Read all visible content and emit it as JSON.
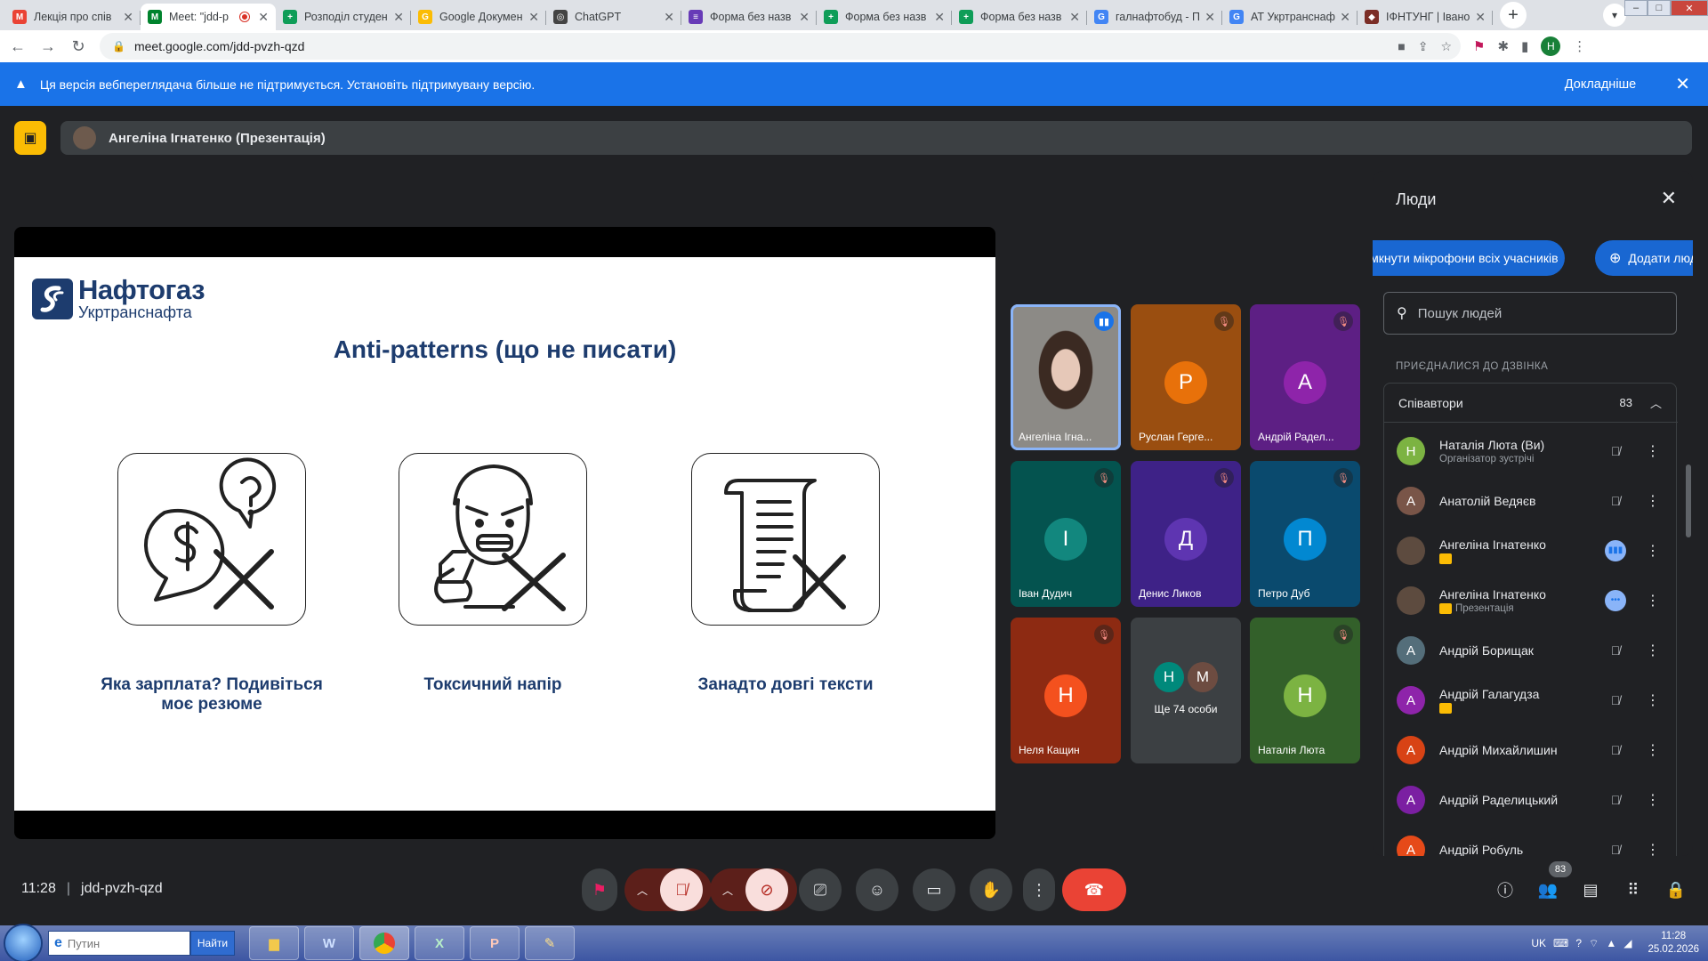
{
  "browser": {
    "tabs": [
      {
        "title": "Лекція про спів",
        "favicon": "M",
        "color": "#ea4335"
      },
      {
        "title": "Meet: \"jdd-p",
        "favicon": "M",
        "color": "#00832d",
        "active": true,
        "recording": true
      },
      {
        "title": "Розподіл студен",
        "favicon": "+",
        "color": "#0f9d58"
      },
      {
        "title": "Google Докумен",
        "favicon": "G",
        "color": "#fbbc04"
      },
      {
        "title": "ChatGPT",
        "favicon": "◎",
        "color": "#444444"
      },
      {
        "title": "Форма без назв",
        "favicon": "≡",
        "color": "#673ab7"
      },
      {
        "title": "Форма без назв",
        "favicon": "+",
        "color": "#0f9d58"
      },
      {
        "title": "Форма без назв",
        "favicon": "+",
        "color": "#0f9d58"
      },
      {
        "title": "галнафтобуд - П",
        "favicon": "G",
        "color": "#4285f4"
      },
      {
        "title": "АТ Укртранснаф",
        "favicon": "G",
        "color": "#4285f4"
      },
      {
        "title": "ІФНТУНГ | Івано",
        "favicon": "◆",
        "color": "#7b2d26"
      }
    ],
    "new_tab_label": "+",
    "url": "meet.google.com/jdd-pvzh-qzd",
    "profile_initial": "Н"
  },
  "banner": {
    "message": "Ця версія вебпереглядача більше не підтримується. Установіть підтримувану версію.",
    "more_label": "Докладніше"
  },
  "presentation": {
    "presenter_label": "Ангеліна Ігнатенко (Презентація)"
  },
  "slide": {
    "logo_title": "Нафтогаз",
    "logo_subtitle": "Укртранснафта",
    "title": "Anti-patterns (що не писати)",
    "captions": [
      "Яка зарплата? Подивіться моє резюме",
      "Токсичний напір",
      "Занадто довгі тексти"
    ]
  },
  "tiles": [
    {
      "name": "Ангеліна Ігна...",
      "initial": "",
      "bg": "#6b6661",
      "avatar_color": "",
      "mic": "talking",
      "video": true,
      "highlight": true
    },
    {
      "name": "Руслан Герге...",
      "initial": "Р",
      "bg": "#9a4e10",
      "avatar_color": "#e8710a",
      "mic": "off"
    },
    {
      "name": "Андрій Радел...",
      "initial": "А",
      "bg": "#5d1f84",
      "avatar_color": "#8e24aa",
      "mic": "off"
    },
    {
      "name": "Іван Дудич",
      "initial": "І",
      "bg": "#04534f",
      "avatar_color": "#12877e",
      "mic": "off"
    },
    {
      "name": "Денис Ликов",
      "initial": "Д",
      "bg": "#3e2287",
      "avatar_color": "#5e35b1",
      "mic": "off"
    },
    {
      "name": "Петро Дуб",
      "initial": "П",
      "bg": "#0a4a6e",
      "avatar_color": "#0288d1",
      "mic": "off"
    },
    {
      "name": "Неля Кащин",
      "initial": "Н",
      "bg": "#8d2a12",
      "avatar_color": "#f4511e",
      "mic": "off"
    },
    {
      "name": "",
      "initial": "",
      "bg": "#3c4043",
      "more_label": "Ще 74 особи",
      "more_initials": [
        "Н",
        "М"
      ],
      "more_colors": [
        "#00897b",
        "#6d4c41"
      ]
    },
    {
      "name": "Наталія Люта",
      "initial": "Н",
      "bg": "#33602a",
      "avatar_color": "#7cb342",
      "mic": "off"
    }
  ],
  "people_panel": {
    "title": "Люди",
    "mute_all_label": "Вимкнути мікрофони всіх учасників",
    "add_people_label": "Додати люде",
    "search_placeholder": "Пошук людей",
    "joined_label": "ПРИЄДНАЛИСЯ ДО ДЗВІНКА",
    "group_label": "Співавтори",
    "group_count": "83",
    "people": [
      {
        "name": "Наталія Люта (Ви)",
        "sub": "Організатор зустрічі",
        "initial": "Н",
        "color": "#7cb342",
        "mic": "off"
      },
      {
        "name": "Анатолій Ведяєв",
        "sub": "",
        "initial": "А",
        "color": "#795548",
        "mic": "off"
      },
      {
        "name": "Ангеліна Ігнатенко",
        "sub": "",
        "initial": "",
        "color": "#5d4b3f",
        "mic": "talking",
        "tag": true
      },
      {
        "name": "Ангеліна Ігнатенко",
        "sub": "Презентація",
        "initial": "",
        "color": "#5d4b3f",
        "mic": "idle",
        "tag": true
      },
      {
        "name": "Андрій Борищак",
        "sub": "",
        "initial": "А",
        "color": "#546e7a",
        "mic": "off"
      },
      {
        "name": "Андрій Галагудза",
        "sub": "",
        "initial": "А",
        "color": "#8e24aa",
        "mic": "off",
        "tag": true
      },
      {
        "name": "Андрій Михайлишин",
        "sub": "",
        "initial": "А",
        "color": "#d84315",
        "mic": "off"
      },
      {
        "name": "Андрій Раделицький",
        "sub": "",
        "initial": "А",
        "color": "#7b1fa2",
        "mic": "off"
      },
      {
        "name": "Андрій Робуль",
        "sub": "",
        "initial": "А",
        "color": "#e64a19",
        "mic": "off"
      }
    ]
  },
  "controls": {
    "time": "11:28",
    "meeting_code": "jdd-pvzh-qzd",
    "people_count": "83"
  },
  "taskbar": {
    "search_value": "Путин",
    "search_button": "Найти",
    "language": "UK",
    "clock_time": "11:28",
    "clock_date": "25.02.2026"
  }
}
